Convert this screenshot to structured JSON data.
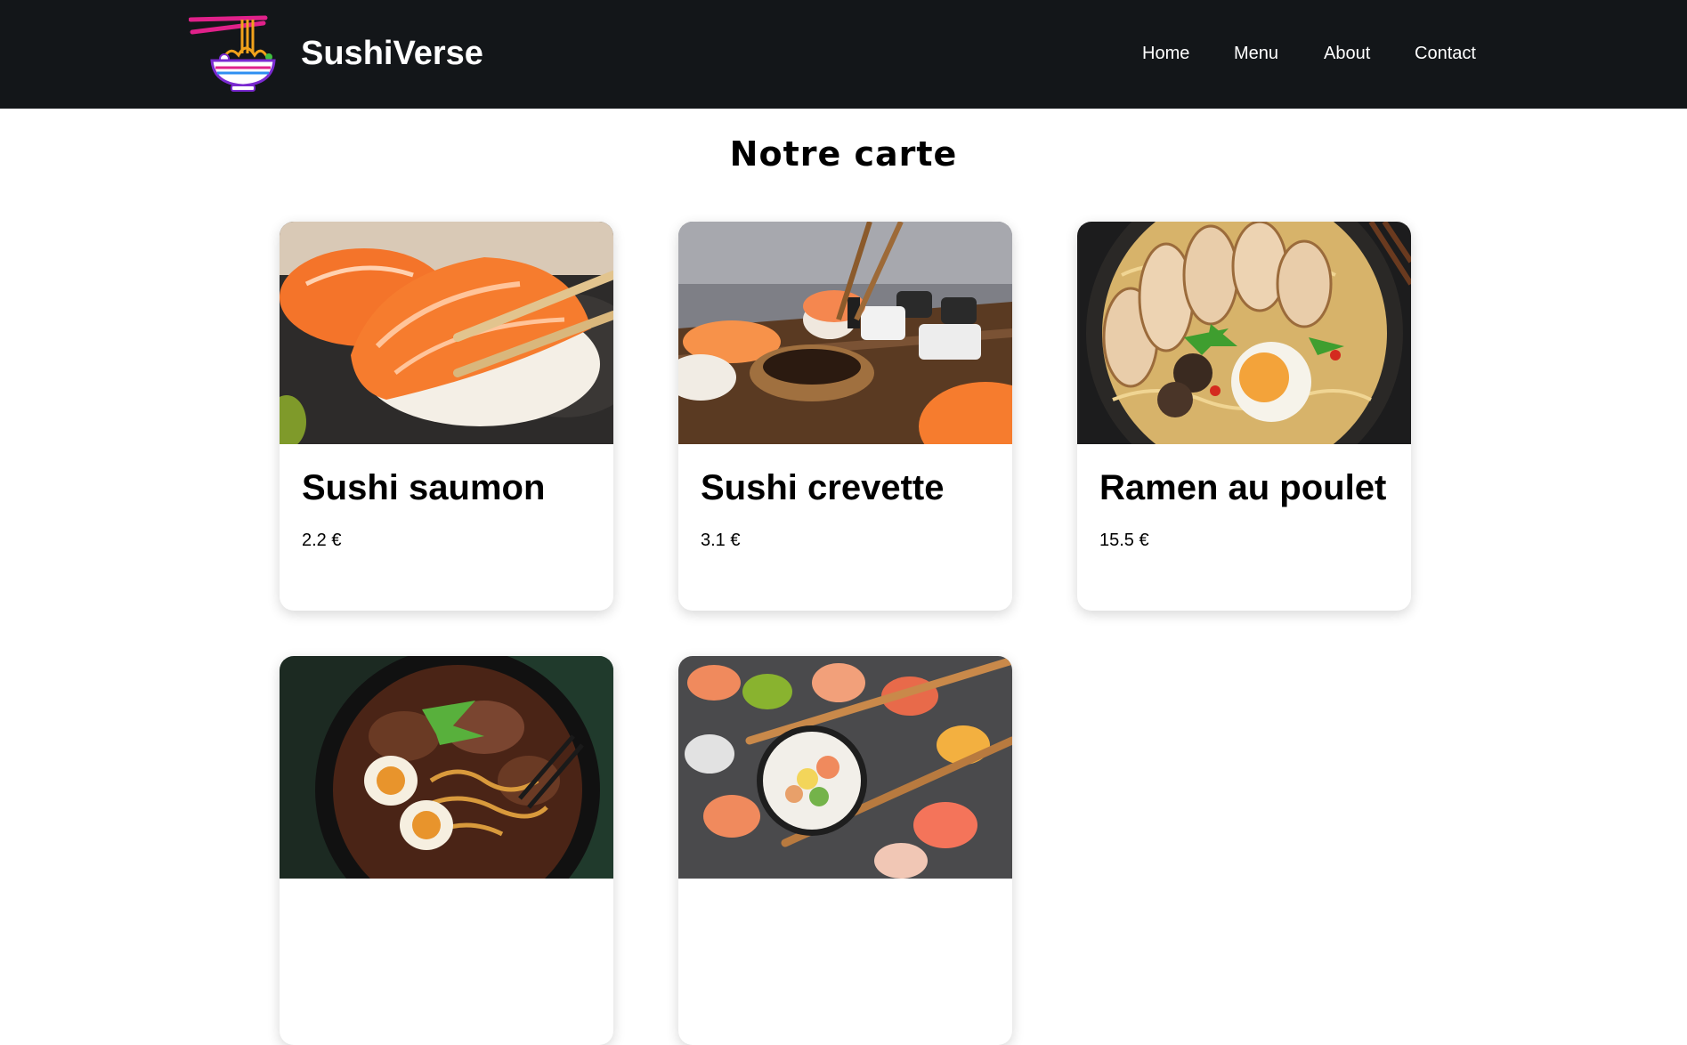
{
  "header": {
    "brand": "SushiVerse",
    "nav": [
      {
        "label": "Home"
      },
      {
        "label": "Menu"
      },
      {
        "label": "About"
      },
      {
        "label": "Contact"
      }
    ]
  },
  "main": {
    "title": "Notre carte",
    "items": [
      {
        "name": "Sushi saumon",
        "price": "2.2 €"
      },
      {
        "name": "Sushi crevette",
        "price": "3.1 €"
      },
      {
        "name": "Ramen au poulet",
        "price": "15.5 €"
      },
      {
        "name": "",
        "price": ""
      },
      {
        "name": "",
        "price": ""
      }
    ]
  },
  "colors": {
    "navbar_bg": "#131619",
    "nav_text": "#ffffff",
    "page_bg": "#ffffff"
  }
}
